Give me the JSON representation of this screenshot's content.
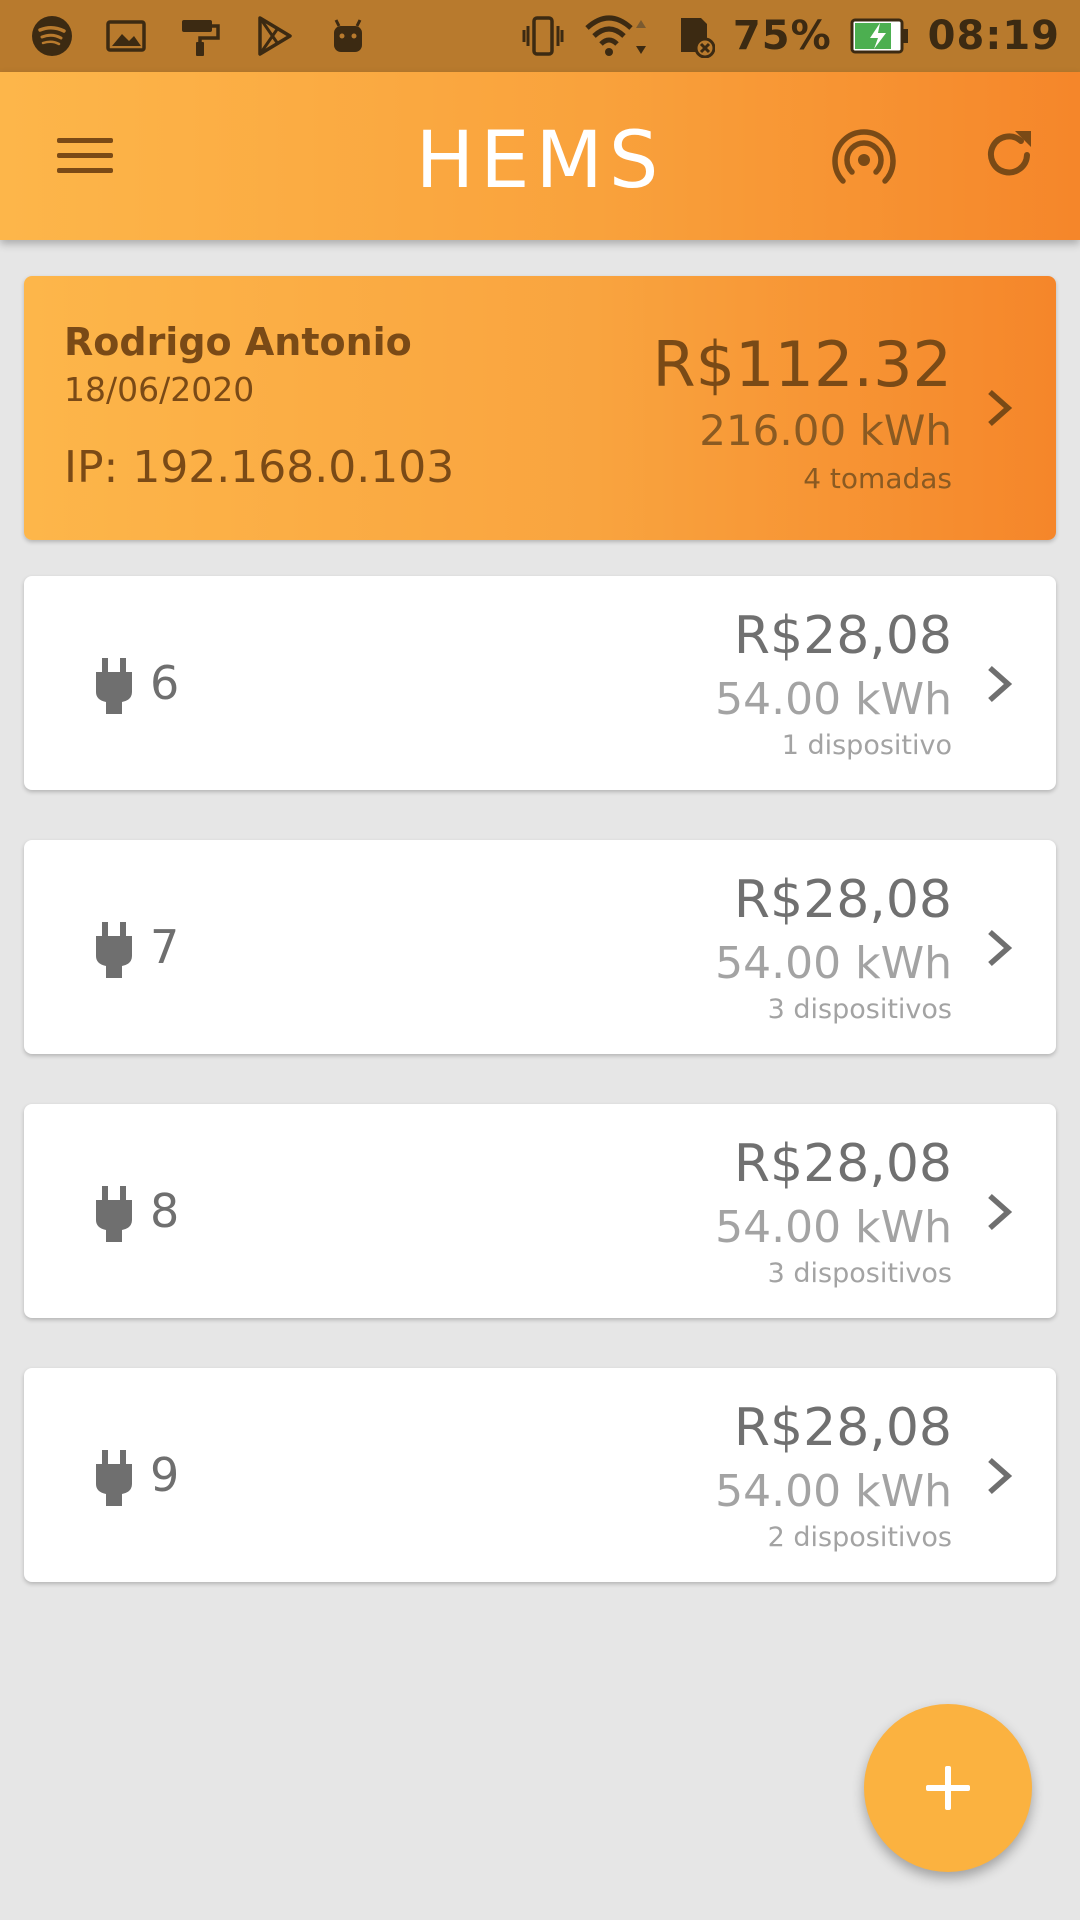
{
  "status_bar": {
    "icons": [
      "spotify-icon",
      "image-icon",
      "paint-roller-icon",
      "play-store-icon",
      "android-icon",
      "vibrate-icon",
      "wifi-icon",
      "sd-card-icon",
      "battery-charging-icon"
    ],
    "battery": "75%",
    "time": "08:19"
  },
  "app_bar": {
    "title": "HEMS",
    "menu_icon": "hamburger-menu-icon",
    "actions": [
      "broadcast-icon",
      "refresh-icon"
    ]
  },
  "summary": {
    "name": "Rodrigo Antonio",
    "date": "18/06/2020",
    "ip": "IP: 192.168.0.103",
    "price": "R$112.32",
    "energy": "216.00 kWh",
    "count": "4 tomadas"
  },
  "outlets": [
    {
      "number": "6",
      "price": "R$28,08",
      "energy": "54.00 kWh",
      "devices": "1 dispositivo"
    },
    {
      "number": "7",
      "price": "R$28,08",
      "energy": "54.00 kWh",
      "devices": "3 dispositivos"
    },
    {
      "number": "8",
      "price": "R$28,08",
      "energy": "54.00 kWh",
      "devices": "3 dispositivos"
    },
    {
      "number": "9",
      "price": "R$28,08",
      "energy": "54.00 kWh",
      "devices": "2 dispositivos"
    }
  ],
  "fab": {
    "icon": "plus-icon"
  },
  "colors": {
    "accent": "#f9a23c",
    "accent_dark": "#f5862a",
    "status_bar": "#b87a2d",
    "summary_text": "#7a4a16",
    "background": "#e6e6e6"
  }
}
